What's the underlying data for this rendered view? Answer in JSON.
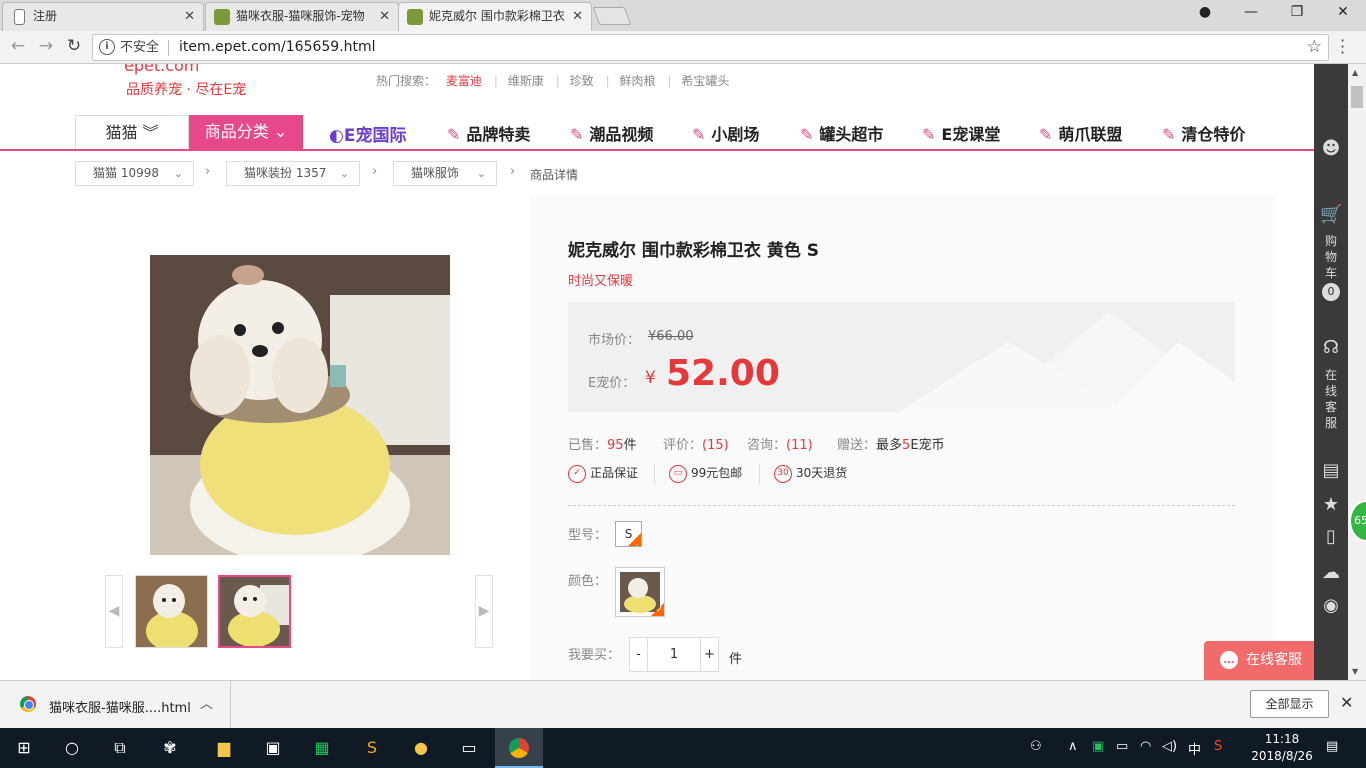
{
  "browser": {
    "tabs": [
      {
        "title": "注册"
      },
      {
        "title": "猫咪衣服-猫咪服饰-宠物"
      },
      {
        "title": "妮克威尔 围巾款彩棉卫衣"
      }
    ],
    "insecure_label": "不安全",
    "url": "item.epet.com/165659.html"
  },
  "header": {
    "slogan": "品质养宠 · 尽在E宠",
    "logo_text": "epet.com",
    "hot_search_label": "热门搜索：",
    "hot_search": [
      "麦富迪",
      "维斯康",
      "珍致",
      "鲜肉粮",
      "希宝罐头"
    ]
  },
  "nav": {
    "category": "猫猫",
    "sort": "商品分类",
    "intl": "E宠国际",
    "items": [
      "品牌特卖",
      "潮品视频",
      "小剧场",
      "罐头超市",
      "E宠课堂",
      "萌爪联盟",
      "清仓特价"
    ]
  },
  "breadcrumb": {
    "items": [
      "猫猫 10998",
      "猫咪装扮 1357",
      "猫咪服饰"
    ],
    "current": "商品详情"
  },
  "product": {
    "title": "妮克威尔 围巾款彩棉卫衣 黄色 S",
    "subtitle": "时尚又保暖",
    "market_label": "市场价：",
    "market_price": "¥66.00",
    "price_label": "E宠价：",
    "price_symbol": "¥",
    "price": "52.00",
    "sold_label": "已售：",
    "sold_value": "95",
    "sold_unit": "件",
    "review_label": "评价：",
    "review_value": "(15)",
    "consult_label": "咨询：",
    "consult_value": "(11)",
    "gift_label": "赠送：",
    "gift_value_pre": "最多",
    "gift_value_num": "5",
    "gift_value_post": "E宠币",
    "guarantees": [
      {
        "icon": "shield-icon",
        "label": "正品保证"
      },
      {
        "icon": "truck-icon",
        "label": "99元包邮"
      },
      {
        "icon": "return-30-icon",
        "label": "30天退货"
      }
    ],
    "model_label": "型号：",
    "model_value": "S",
    "color_label": "颜色：",
    "qty_label": "我要买：",
    "qty_minus": "-",
    "qty_value": "1",
    "qty_plus": "+",
    "qty_unit": "件"
  },
  "sidebar": {
    "cart_label": "购物车",
    "cart_count": "0",
    "service_label": "在线客服",
    "float_badge": "65"
  },
  "chat_button": "在线客服",
  "download_bar": {
    "filename": "猫咪衣服-猫咪服....html",
    "show_all": "全部显示"
  },
  "taskbar": {
    "ime": "中",
    "time": "11:18",
    "date": "2018/8/26"
  },
  "colors": {
    "brand_pink": "#e6488a",
    "price_red": "#e4393c",
    "chat_red": "#f26b6b"
  }
}
